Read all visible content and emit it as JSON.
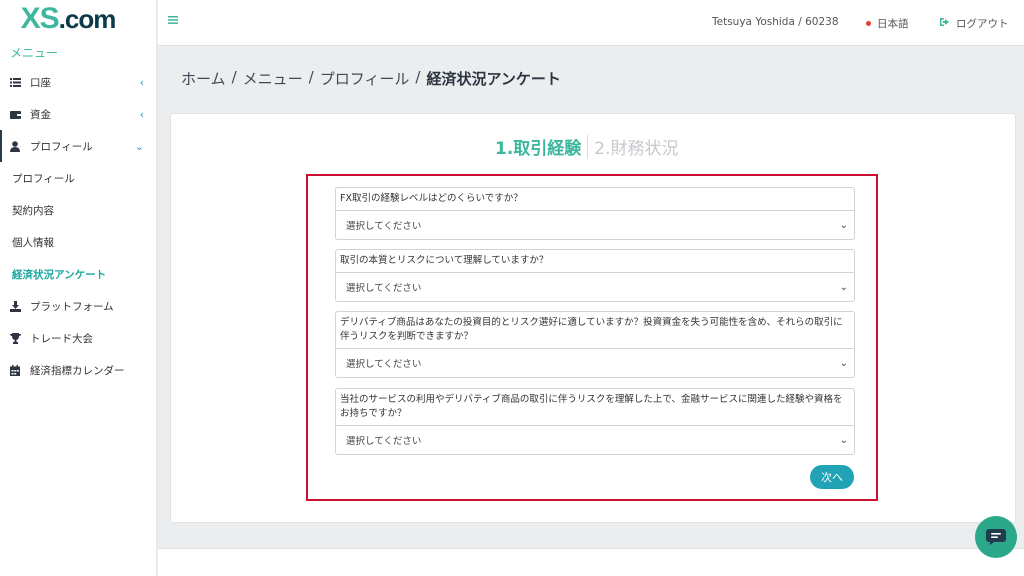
{
  "brand": {
    "logo_main": "XS",
    "logo_suffix": ".com"
  },
  "sidebar": {
    "heading": "メニュー",
    "items": [
      {
        "label": "口座",
        "icon": "list-icon",
        "expanded": false
      },
      {
        "label": "資金",
        "icon": "wallet-icon",
        "expanded": false
      },
      {
        "label": "プロフィール",
        "icon": "user-icon",
        "expanded": true
      },
      {
        "label": "プラットフォーム",
        "icon": "download-icon"
      },
      {
        "label": "トレード大会",
        "icon": "trophy-icon"
      },
      {
        "label": "経済指標カレンダー",
        "icon": "calendar-icon"
      }
    ],
    "sub_items": [
      "プロフィール",
      "契約内容",
      "個人情報",
      "経済状況アンケート"
    ]
  },
  "header": {
    "user": "Tetsuya Yoshida / 60238",
    "language": "日本語",
    "logout": "ログアウト"
  },
  "breadcrumb": {
    "items": [
      "ホーム",
      "メニュー",
      "プロフィール",
      "経済状況アンケート"
    ],
    "separator": "/"
  },
  "steps": {
    "active": "1.取引経験",
    "inactive": "2.財務状況"
  },
  "questions": [
    {
      "label": "FX取引の経験レベルはどのくらいですか？",
      "value": "選択してください"
    },
    {
      "label": "取引の本質とリスクについて理解していますか？",
      "value": "選択してください"
    },
    {
      "label": "デリバティブ商品はあなたの投資目的とリスク選好に適していますか？投資資金を失う可能性を含め、それらの取引に伴うリスクを判断できますか？",
      "value": "選択してください"
    },
    {
      "label": "当社のサービスの利用やデリバティブ商品の取引に伴うリスクを理解した上で、金融サービスに関連した経験や資格をお持ちですか？",
      "value": "選択してください"
    }
  ],
  "next_button": "次へ",
  "colors": {
    "accent": "#3db89e",
    "button": "#1fa3b5",
    "highlight": "#c8102e"
  }
}
